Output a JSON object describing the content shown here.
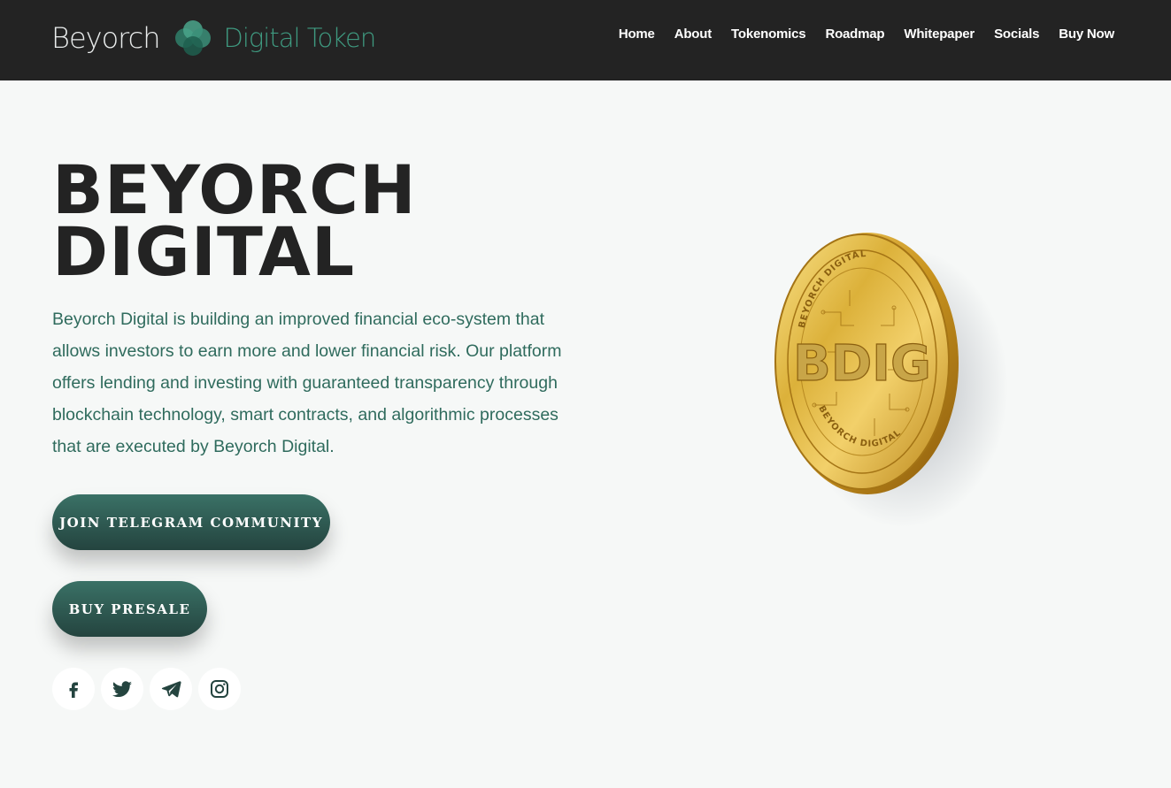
{
  "header": {
    "logo_word_1": "Beyorch",
    "logo_word_2": "Digital Token",
    "nav": [
      "Home",
      "About",
      "Tokenomics",
      "Roadmap",
      "Whitepaper",
      "Socials",
      "Buy Now"
    ]
  },
  "hero": {
    "title_line_1": "BEYORCH",
    "title_line_2": "DIGITAL",
    "description": "Beyorch Digital is building an improved financial eco-system that allows investors to earn more and lower financial risk.  Our platform offers lending and investing with guaranteed transparency through blockchain technology, smart contracts, and algorithmic processes that are executed by Beyorch Digital.",
    "telegram_button": "JOIN TELEGRAM COMMUNITY",
    "presale_button": "BUY PRESALE"
  },
  "coin": {
    "center_text": "BDIG",
    "rim_text_top": "BEYORCH DIGITAL",
    "rim_text_bottom": "BEYORCH DIGITAL"
  },
  "socials": [
    {
      "name": "facebook-icon"
    },
    {
      "name": "twitter-icon"
    },
    {
      "name": "telegram-icon"
    },
    {
      "name": "instagram-icon"
    }
  ],
  "colors": {
    "header_bg": "#232323",
    "page_bg": "#f6f8f7",
    "accent_teal": "#3f9a80",
    "button_dark": "#24443f",
    "text_teal": "#2f6b5d",
    "gold": "#d4a832"
  }
}
